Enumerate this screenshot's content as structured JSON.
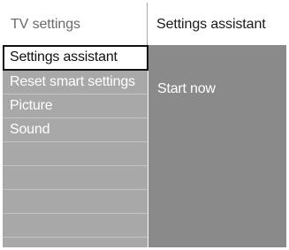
{
  "header": {
    "left_title": "TV settings",
    "right_title": "Settings assistant"
  },
  "menu": {
    "items": [
      {
        "label": "Settings assistant"
      },
      {
        "label": "Reset smart settings"
      },
      {
        "label": "Picture"
      },
      {
        "label": "Sound"
      },
      {
        "label": ""
      },
      {
        "label": ""
      },
      {
        "label": ""
      },
      {
        "label": ""
      }
    ]
  },
  "submenu": {
    "items": [
      {
        "label": "Start now"
      }
    ]
  },
  "colors": {
    "left_panel": "#a8a8a8",
    "right_panel": "#8a8a8a",
    "selection_bg": "#ffffff",
    "selection_border": "#111111"
  }
}
